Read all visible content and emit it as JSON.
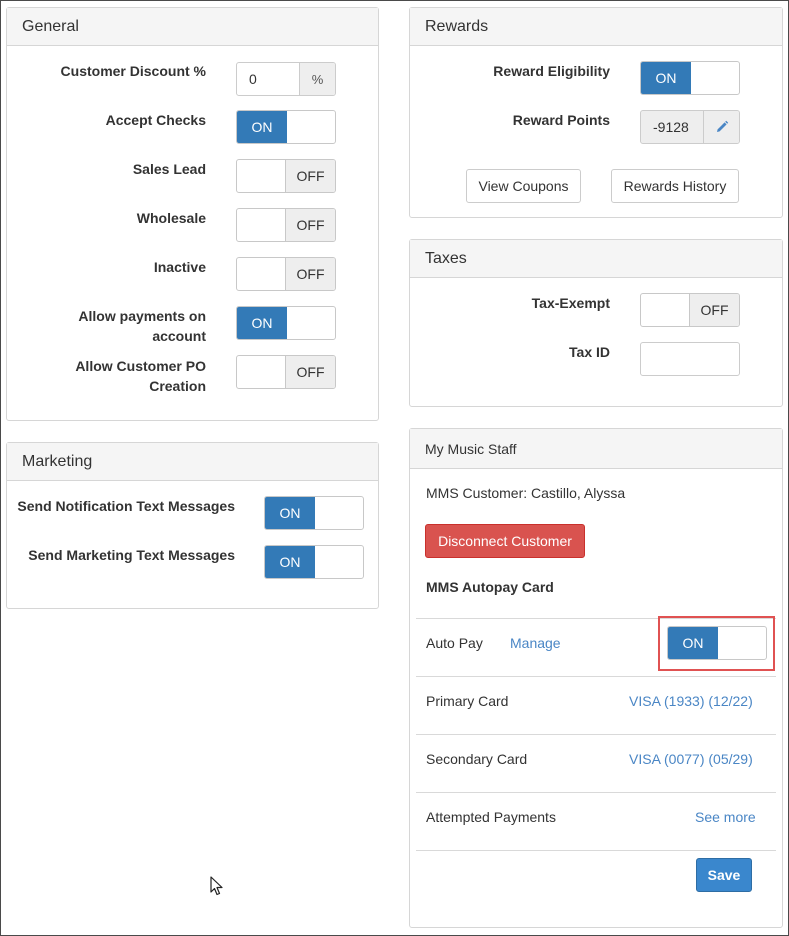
{
  "general": {
    "title": "General",
    "customer_discount": {
      "label": "Customer Discount %",
      "value": "0",
      "addon": "%"
    },
    "accept_checks": {
      "label": "Accept Checks",
      "state": "ON"
    },
    "sales_lead": {
      "label": "Sales Lead",
      "state": "OFF"
    },
    "wholesale": {
      "label": "Wholesale",
      "state": "OFF"
    },
    "inactive": {
      "label": "Inactive",
      "state": "OFF"
    },
    "allow_payments": {
      "label_line1": "Allow payments on",
      "label_line2": "account",
      "state": "ON"
    },
    "allow_po": {
      "label_line1": "Allow Customer PO",
      "label_line2": "Creation",
      "state": "OFF"
    }
  },
  "marketing": {
    "title": "Marketing",
    "notification_texts": {
      "label": "Send Notification Text Messages",
      "state": "ON"
    },
    "marketing_texts": {
      "label": "Send Marketing Text Messages",
      "state": "ON"
    }
  },
  "rewards": {
    "title": "Rewards",
    "eligibility": {
      "label": "Reward Eligibility",
      "state": "ON"
    },
    "points": {
      "label": "Reward Points",
      "value": "-9128"
    },
    "view_coupons_label": "View Coupons",
    "rewards_history_label": "Rewards History"
  },
  "taxes": {
    "title": "Taxes",
    "tax_exempt": {
      "label": "Tax-Exempt",
      "state": "OFF"
    },
    "tax_id": {
      "label": "Tax ID",
      "value": ""
    }
  },
  "mms": {
    "title": "My Music Staff",
    "customer_text": "MMS Customer: Castillo, Alyssa",
    "disconnect_label": "Disconnect Customer",
    "autopay_card_heading": "MMS Autopay Card",
    "auto_pay": {
      "label": "Auto Pay",
      "manage_label": "Manage",
      "state": "ON"
    },
    "primary_card": {
      "label": "Primary Card",
      "value": "VISA (1933) (12/22)"
    },
    "secondary_card": {
      "label": "Secondary Card",
      "value": "VISA (0077) (05/29)"
    },
    "attempted_payments": {
      "label": "Attempted Payments",
      "link": "See more"
    },
    "save_label": "Save"
  },
  "colors": {
    "primary": "#337ab7",
    "danger": "#d9534f",
    "link": "#4a86c5",
    "highlight": "#e05252"
  }
}
